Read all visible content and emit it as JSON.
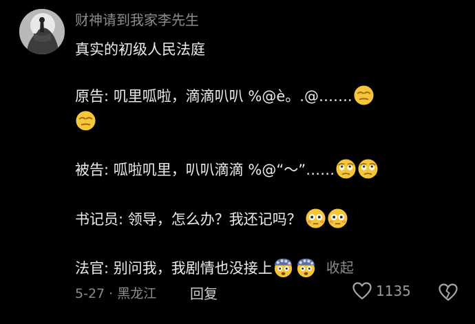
{
  "comment": {
    "username": "财神请到我家李先生",
    "title": "真实的初级人民法庭",
    "plaintiff": "原告: 叽里呱啦，滴滴叭叭 %@è。.@…….",
    "defendant": "被告: 呱啦叽里，叭叭滴滴 %@“～”……",
    "clerk": "书记员: 领导，怎么办？我还记吗？",
    "judge": "法官: 别问我，我剧情也没接上",
    "collapse_label": "收起",
    "date_location": "5-27 · 黑龙江",
    "reply_label": "回复",
    "like_count": "1135"
  },
  "icons": {
    "plaintiff_emoji": "smirk-face-emoji",
    "defendant_emoji": "rolling-eyes-face-emoji",
    "clerk_emoji": "flushed-face-emoji",
    "judge_emoji": "exploding-head-face-emoji",
    "like": "heart-outline-icon",
    "dislike": "broken-heart-icon"
  },
  "colors": {
    "background": "#000000",
    "text": "#ececec",
    "muted": "#8c8c8c",
    "emoji_yellow": "#f6c63a"
  }
}
